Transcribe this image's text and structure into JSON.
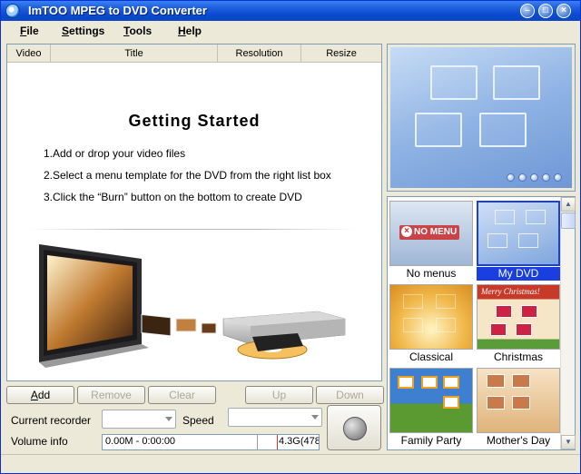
{
  "window": {
    "title": "ImTOO MPEG to DVD Converter"
  },
  "menu": {
    "file": {
      "accel": "F",
      "rest": "ile"
    },
    "settings": {
      "accel": "S",
      "rest": "ettings"
    },
    "tools": {
      "accel": "T",
      "rest": "ools"
    },
    "help": {
      "accel": "H",
      "rest": "elp"
    }
  },
  "list": {
    "columns": [
      "Video",
      "Title",
      "Resolution",
      "Resize"
    ],
    "getting_started": {
      "title": "Getting Started",
      "steps": [
        "1.Add or drop your video files",
        "2.Select a menu template for the DVD from the right list box",
        "3.Click the “Burn” button on the bottom to create DVD"
      ]
    }
  },
  "buttons": {
    "add": {
      "accel": "A",
      "rest": "dd"
    },
    "remove": "Remove",
    "clear": "Clear",
    "up": "Up",
    "down": "Down"
  },
  "controls": {
    "current_recorder_label": "Current recorder",
    "current_recorder_value": "",
    "speed_label": "Speed",
    "speed_value": "",
    "volume_label": "Volume info",
    "volume_used": "0.00M - 0:00:00",
    "volume_total": "4.3G(478"
  },
  "templates": [
    {
      "label": "No menus",
      "badge": "NO MENU",
      "selected": false
    },
    {
      "label": "My DVD",
      "selected": true
    },
    {
      "label": "Classical",
      "selected": false
    },
    {
      "label": "Christmas",
      "badge": "Merry Christmas!",
      "selected": false
    },
    {
      "label": "Family Party",
      "selected": false
    },
    {
      "label": "Mother's Day",
      "selected": false
    }
  ],
  "colors": {
    "selection": "#1a3ee0",
    "titlebar": "#0a4ad0"
  }
}
